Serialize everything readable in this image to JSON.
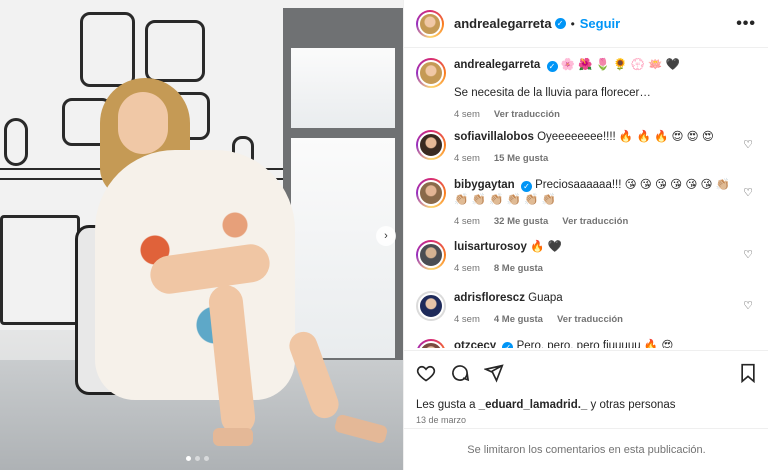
{
  "post": {
    "account": "andrealegarreta",
    "follow_label": "Seguir",
    "more_label": "•••",
    "separator": "•",
    "verified_mark": "✓",
    "next_arrow": "›",
    "caption": {
      "emoji": "🌸 🌺 🌷 🌻 💮 🪷 🖤",
      "text": "Se necesita de la lluvia para florecer…",
      "time": "4 sem",
      "translate": "Ver traducción"
    }
  },
  "comments": [
    {
      "user": "sofiavillalobos",
      "verified": false,
      "text": "Oyeeeeeeee!!!! 🔥 🔥 🔥 😍 😍 😍",
      "time": "4 sem",
      "likes": "15 Me gusta",
      "translate": ""
    },
    {
      "user": "bibygaytan",
      "verified": true,
      "text": "Preciosaaaaaa!!! 😘 😘 😘 😘 😘 😘 👏🏼 👏🏼 👏🏼 👏🏼 👏🏼 👏🏼 👏🏼",
      "time": "4 sem",
      "likes": "32 Me gusta",
      "translate": "Ver traducción"
    },
    {
      "user": "luisarturosoy",
      "verified": false,
      "text": "🔥 🖤",
      "time": "4 sem",
      "likes": "8 Me gusta",
      "translate": ""
    },
    {
      "user": "adrisflorescz",
      "verified": false,
      "text": "Guapa",
      "time": "4 sem",
      "likes": "4 Me gusta",
      "translate": "Ver traducción"
    },
    {
      "user": "otzcecy",
      "verified": true,
      "text": "Pero, pero, pero fiuuuuu 🔥 😍",
      "time": "",
      "likes": "",
      "translate": ""
    }
  ],
  "likes_line": {
    "prefix": "Les gusta a",
    "user": "_eduard_lamadrid._",
    "suffix": "y otras personas"
  },
  "date": "13 de marzo",
  "limited_notice": "Se limitaron los comentarios en esta publicación.",
  "icons": [
    "heart-icon",
    "comment-icon",
    "share-icon",
    "bookmark-icon",
    "more-icon"
  ]
}
